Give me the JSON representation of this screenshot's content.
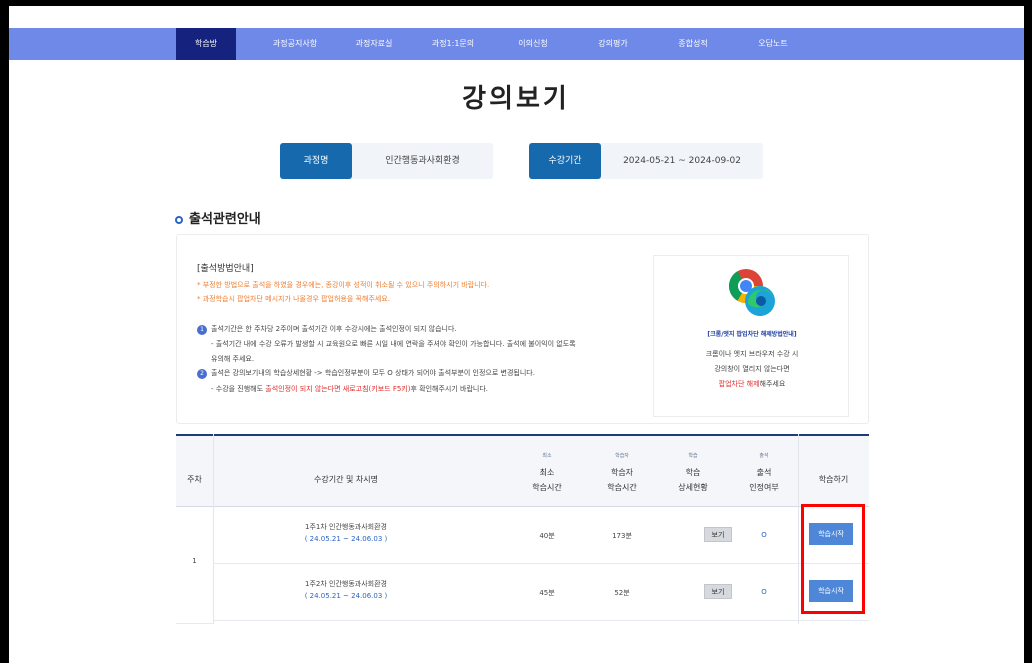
{
  "nav": {
    "items": [
      "학습방",
      "과정공지사항",
      "과정자료실",
      "과정1:1문의",
      "이의신청",
      "강의평가",
      "종합성적",
      "오답노트"
    ],
    "active_index": 0,
    "color": "#6f89e8",
    "active_color": "#15237e"
  },
  "page_title": "강의보기",
  "course": {
    "label": "과정명",
    "value": "인간행동과사회환경",
    "period_label": "수강기간",
    "period_value": "2024-05-21 ~ 2024-09-02"
  },
  "attendance": {
    "title": "출석관련안내",
    "method_heading": "[출석방법안내]",
    "warnings": [
      "* 부정한 방법으로 출석을 하였을 경우에는, 종강이후 성적이 취소될 수 있으니 주의하시기 바랍니다.",
      "* 과정학습시 팝업차단 메시지가 나올경우 팝업허용을 꼭해주세요."
    ],
    "item1_num": "1",
    "item1": "출석기간은 한 주차당 2주이며 출석기간 이후 수강시에는 출석인정이 되지 않습니다.",
    "item1_sub1": "- 출석기간 내에 수강 오류가 발생할 시 교육원으로 빠른 시일 내에 연락을 주셔야 확인이 가능합니다. 출석에 불이익이 없도록",
    "item1_sub2": "유의해 주세요.",
    "item2_num": "2",
    "item2": "출석은 강의보기내의 학습상세현황 -> 학습인정부분이 모두 O 상태가 되어야 출석부분이 인정으로 변경됩니다.",
    "item2_sub_prefix": "- 수강을 진행해도 ",
    "item2_sub_red": "출석인정이 되지 않는다면 새로고침(키보드 F5키)",
    "item2_sub_suffix": "후 확인해주시기 바랍니다.",
    "browser": {
      "link": "[크롬/엣지 팝업차단 해제방법안내]",
      "line1": "크롬이나 엣지 브라우저 수강 시",
      "line2": "강의창이 열리지 않는다면",
      "line3_red": "팝업차단 해제",
      "line3_suffix": "해주세요"
    }
  },
  "table": {
    "headers": {
      "week": "주차",
      "title": "수강기간 및 차시명",
      "min_small": "최소",
      "min_line1": "최소",
      "min_line2": "학습시간",
      "study_small": "학습자",
      "study_line1": "학습자",
      "study_line2": "학습시간",
      "detail_small": "학습",
      "detail_line1": "학습",
      "detail_line2": "상세현황",
      "attend_small": "출석",
      "attend_line1": "출석",
      "attend_line2": "인정여부",
      "action": "학습하기"
    },
    "week": "1",
    "rows": [
      {
        "title": "1주1차 인간행동과사회환경",
        "period": "( 24.05.21 ~ 24.06.03 )",
        "min_time": "40분",
        "study_time": "173분",
        "detail_btn": "보기",
        "attend": "O",
        "start_btn": "학습시작"
      },
      {
        "title": "1주2차 인간행동과사회환경",
        "period": "( 24.05.21 ~ 24.06.03 )",
        "min_time": "45분",
        "study_time": "52분",
        "detail_btn": "보기",
        "attend": "O",
        "start_btn": "학습시작"
      }
    ]
  },
  "highlight_color": "#ff0000"
}
